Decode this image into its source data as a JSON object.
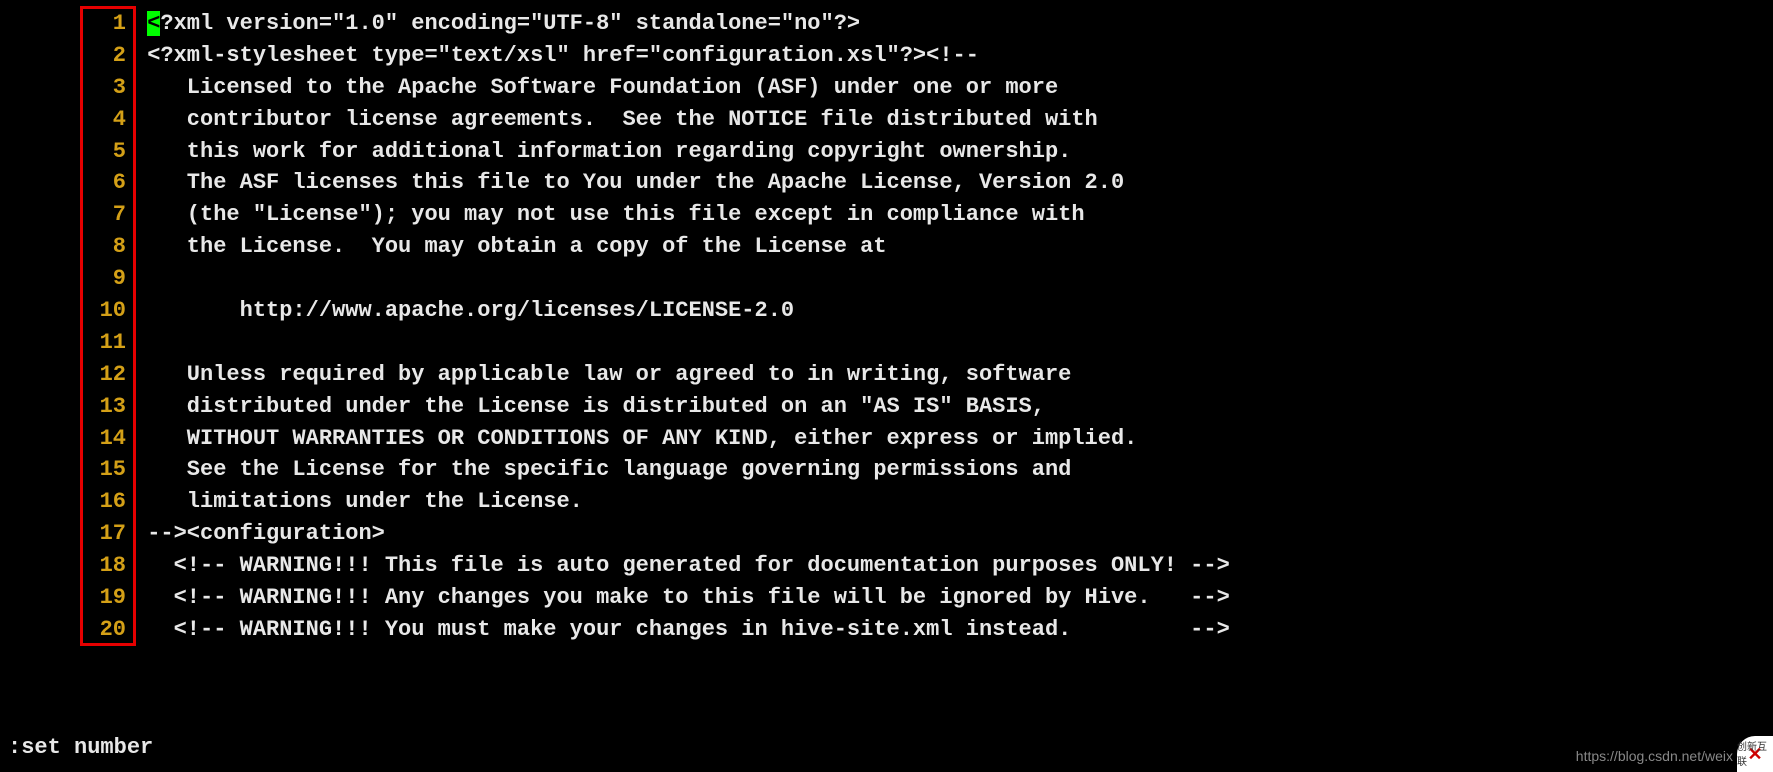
{
  "lines": [
    {
      "num": "1",
      "text": "<?xml version=\"1.0\" encoding=\"UTF-8\" standalone=\"no\"?>",
      "cursorCol": 0
    },
    {
      "num": "2",
      "text": "<?xml-stylesheet type=\"text/xsl\" href=\"configuration.xsl\"?><!--"
    },
    {
      "num": "3",
      "text": "   Licensed to the Apache Software Foundation (ASF) under one or more"
    },
    {
      "num": "4",
      "text": "   contributor license agreements.  See the NOTICE file distributed with"
    },
    {
      "num": "5",
      "text": "   this work for additional information regarding copyright ownership."
    },
    {
      "num": "6",
      "text": "   The ASF licenses this file to You under the Apache License, Version 2.0"
    },
    {
      "num": "7",
      "text": "   (the \"License\"); you may not use this file except in compliance with"
    },
    {
      "num": "8",
      "text": "   the License.  You may obtain a copy of the License at"
    },
    {
      "num": "9",
      "text": ""
    },
    {
      "num": "10",
      "text": "       http://www.apache.org/licenses/LICENSE-2.0"
    },
    {
      "num": "11",
      "text": ""
    },
    {
      "num": "12",
      "text": "   Unless required by applicable law or agreed to in writing, software"
    },
    {
      "num": "13",
      "text": "   distributed under the License is distributed on an \"AS IS\" BASIS,"
    },
    {
      "num": "14",
      "text": "   WITHOUT WARRANTIES OR CONDITIONS OF ANY KIND, either express or implied."
    },
    {
      "num": "15",
      "text": "   See the License for the specific language governing permissions and"
    },
    {
      "num": "16",
      "text": "   limitations under the License."
    },
    {
      "num": "17",
      "text": "--><configuration>"
    },
    {
      "num": "18",
      "text": "  <!-- WARNING!!! This file is auto generated for documentation purposes ONLY! -->"
    },
    {
      "num": "19",
      "text": "  <!-- WARNING!!! Any changes you make to this file will be ignored by Hive.   -->"
    },
    {
      "num": "20",
      "text": "  <!-- WARNING!!! You must make your changes in hive-site.xml instead.         -->"
    }
  ],
  "command": ":set number",
  "watermark": "https://blog.csdn.net/weix",
  "brand": "创新互联"
}
